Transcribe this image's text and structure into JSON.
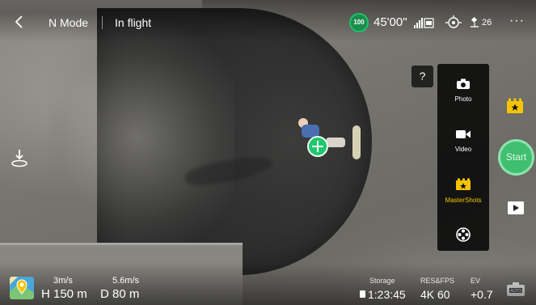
{
  "header": {
    "back_icon": "chevron-left-icon",
    "flight_mode": "N Mode",
    "flight_status": "In flight",
    "battery_percent": "100",
    "flight_time": "45'00\"",
    "gps_count": "26",
    "more_label": "···"
  },
  "help_label": "?",
  "camera_modes": [
    {
      "label": "Photo",
      "icon": "camera-icon",
      "active": false
    },
    {
      "label": "Video",
      "icon": "video-camera-icon",
      "active": false
    },
    {
      "label": "MasterShots",
      "icon": "mastershots-icon",
      "active": true
    },
    {
      "label": "",
      "icon": "film-reel-icon",
      "active": false
    }
  ],
  "start_label": "Start",
  "telemetry": {
    "horizontal_speed": "3m/s",
    "vertical_speed": "5.6m/s",
    "height": "H 150 m",
    "distance": "D 80 m"
  },
  "camera_stats": {
    "storage_label": "Storage",
    "storage_value": "1:23:45",
    "resfps_label": "RES&FPS",
    "resfps_value": "4K 60",
    "ev_label": "EV",
    "ev_value": "+0.7"
  },
  "colors": {
    "accent_green": "#3fbf6f",
    "active_yellow": "#f5c400",
    "panel_bg": "#0c0c0c"
  }
}
